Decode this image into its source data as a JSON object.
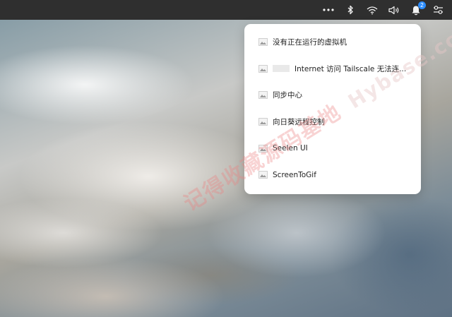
{
  "taskbar": {
    "icons": [
      {
        "name": "more-icon"
      },
      {
        "name": "bluetooth-icon"
      },
      {
        "name": "wifi-icon"
      },
      {
        "name": "volume-icon"
      },
      {
        "name": "notification-bell-icon",
        "badge": "2"
      },
      {
        "name": "settings-sliders-icon"
      }
    ],
    "badge_color": "#2a8cff"
  },
  "tray_menu": {
    "items": [
      {
        "label": "没有正在运行的虚拟机",
        "icon": "app-image-icon"
      },
      {
        "label": "Internet 访问 Tailscale 无法连...",
        "icon": "app-image-icon",
        "redacted_prefix": true
      },
      {
        "label": "同步中心",
        "icon": "app-image-icon"
      },
      {
        "label": "向日葵远程控制",
        "icon": "app-image-icon"
      },
      {
        "label": "Seelen UI",
        "icon": "app-image-icon"
      },
      {
        "label": "ScreenToGif",
        "icon": "app-image-icon"
      }
    ]
  },
  "watermark": {
    "cn": "记得收藏源码基地",
    "en": "Hybase.com"
  }
}
